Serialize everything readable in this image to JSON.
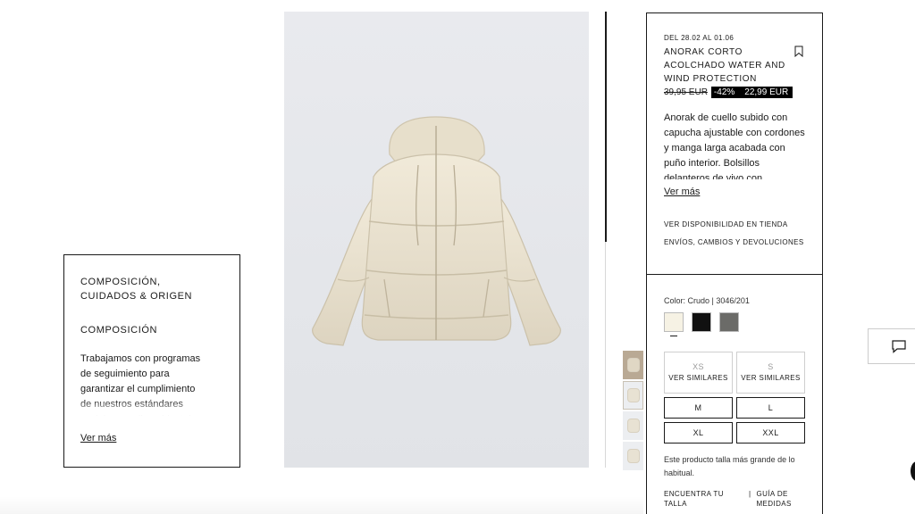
{
  "composition_panel": {
    "title": "COMPOSICIÓN, CUIDADOS & ORIGEN",
    "subtitle": "COMPOSICIÓN",
    "text": "Trabajamos con programas de seguimiento para garantizar el cumplimiento de nuestros estándares sociales, medioambientales",
    "more_link": "Ver más"
  },
  "product": {
    "date_range": "DEL 28.02 AL 01.06",
    "title": "ANORAK CORTO ACOLCHADO WATER AND WIND PROTECTION",
    "old_price": "39,95 EUR",
    "discount": "-42%",
    "new_price": "22,99 EUR",
    "description": "Anorak de cuello subido con capucha ajustable con cordones y manga larga acabada con puño interior. Bolsillos delanteros de vivo con",
    "more_link": "Ver más",
    "store_availability": "VER DISPONIBILIDAD EN TIENDA",
    "shipping": "ENVÍOS, CAMBIOS Y DEVOLUCIONES",
    "bookmark_icon": "bookmark-icon"
  },
  "colors": {
    "label": "Color: Crudo | 3046/201",
    "swatches": [
      {
        "name": "Crudo",
        "hex": "#f6f2e4"
      },
      {
        "name": "Negro",
        "hex": "#111111"
      },
      {
        "name": "Gris",
        "hex": "#6b6b68"
      }
    ]
  },
  "sizes": {
    "unavailable": [
      {
        "size": "XS",
        "label": "VER SIMILARES"
      },
      {
        "size": "S",
        "label": "VER SIMILARES"
      }
    ],
    "available": [
      "M",
      "L",
      "XL",
      "XXL"
    ],
    "note": "Este producto talla más grande de lo habitual.",
    "find_size": "ENCUENTRA TU TALLA",
    "separator": "|",
    "size_guide": "GUÍA DE MEDIDAS"
  },
  "chat": {
    "icon": "chat-icon"
  }
}
